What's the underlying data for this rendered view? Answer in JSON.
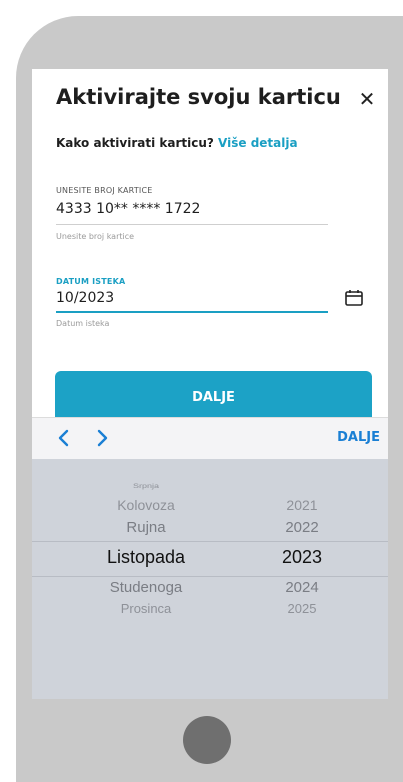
{
  "dialog": {
    "title": "Aktivirajte svoju karticu",
    "close_icon": "close-icon",
    "howto_text": "Kako aktivirati karticu?",
    "howto_link": "Više detalja"
  },
  "card_field": {
    "label": "UNESITE BROJ KARTICE",
    "value": "4333 10** **** 1722",
    "helper": "Unesite broj kartice"
  },
  "expiry_field": {
    "label": "DATUM ISTEKA",
    "value": "10/2023",
    "helper": "Datum isteka",
    "icon": "calendar-icon"
  },
  "primary_button": {
    "label": "DALJE"
  },
  "picker_toolbar": {
    "prev_icon": "chevron-left-icon",
    "next_icon": "chevron-right-icon",
    "done_label": "DALJE"
  },
  "picker": {
    "months": [
      "Srpnja",
      "Kolovoza",
      "Rujna",
      "Listopada",
      "Studenoga",
      "Prosinca"
    ],
    "years": [
      "2021",
      "2022",
      "2023",
      "2024",
      "2025"
    ],
    "selected_month": "Listopada",
    "selected_year": "2023"
  },
  "colors": {
    "accent": "#1ca2c6",
    "toolbar_link": "#1a7fd4",
    "picker_bg": "#cfd3da",
    "device_frame": "#c9c9c9"
  }
}
